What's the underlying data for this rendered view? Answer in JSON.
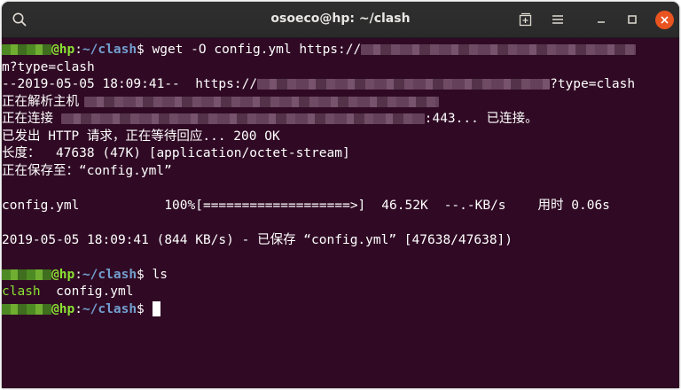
{
  "window": {
    "title": "osoeco@hp: ~/clash"
  },
  "titlebar_icons": {
    "search": "search-icon",
    "new_tab": "new-tab-icon",
    "menu": "hamburger-menu-icon",
    "minimize": "minimize-icon",
    "maximize": "maximize-icon",
    "close": "close-icon"
  },
  "colors": {
    "terminal_bg": "#300a24",
    "prompt_user": "#8ae234",
    "prompt_path": "#729fcf",
    "close_button": "#e95420"
  },
  "terminal": {
    "line1": {
      "host": "@hp",
      "colon": ":",
      "path": "~/clash",
      "dollar": "$",
      "command": " wget -O config.yml https://"
    },
    "line2": "m?type=clash",
    "line3": {
      "prefix": "--2019-05-05 18:09:41--  https://",
      "suffix": "?type=clash"
    },
    "line4": "正在解析主机",
    "line5": {
      "prefix": "正在连接 ",
      "suffix": ":443... 已连接。"
    },
    "line6": "已发出 HTTP 请求，正在等待回应... 200 OK",
    "line7": "长度：  47638 (47K) [application/octet-stream]",
    "line8": "正在保存至：“config.yml”",
    "progress": {
      "filename": "config.yml",
      "bar": "100%[===================>]",
      "size": "46.52K",
      "speed": "--.-KB/s",
      "time": "用时 0.06s"
    },
    "saved": "2019-05-05 18:09:41 (844 KB/s) - 已保存 “config.yml” [47638/47638])",
    "prompt2": {
      "host": "@hp",
      "colon": ":",
      "path": "~/clash",
      "dollar": "$",
      "command": " ls"
    },
    "ls_output": {
      "dir": "clash",
      "file": "config.yml"
    },
    "prompt3": {
      "host": "@hp",
      "colon": ":",
      "path": "~/clash",
      "dollar": "$",
      "command": " "
    }
  }
}
